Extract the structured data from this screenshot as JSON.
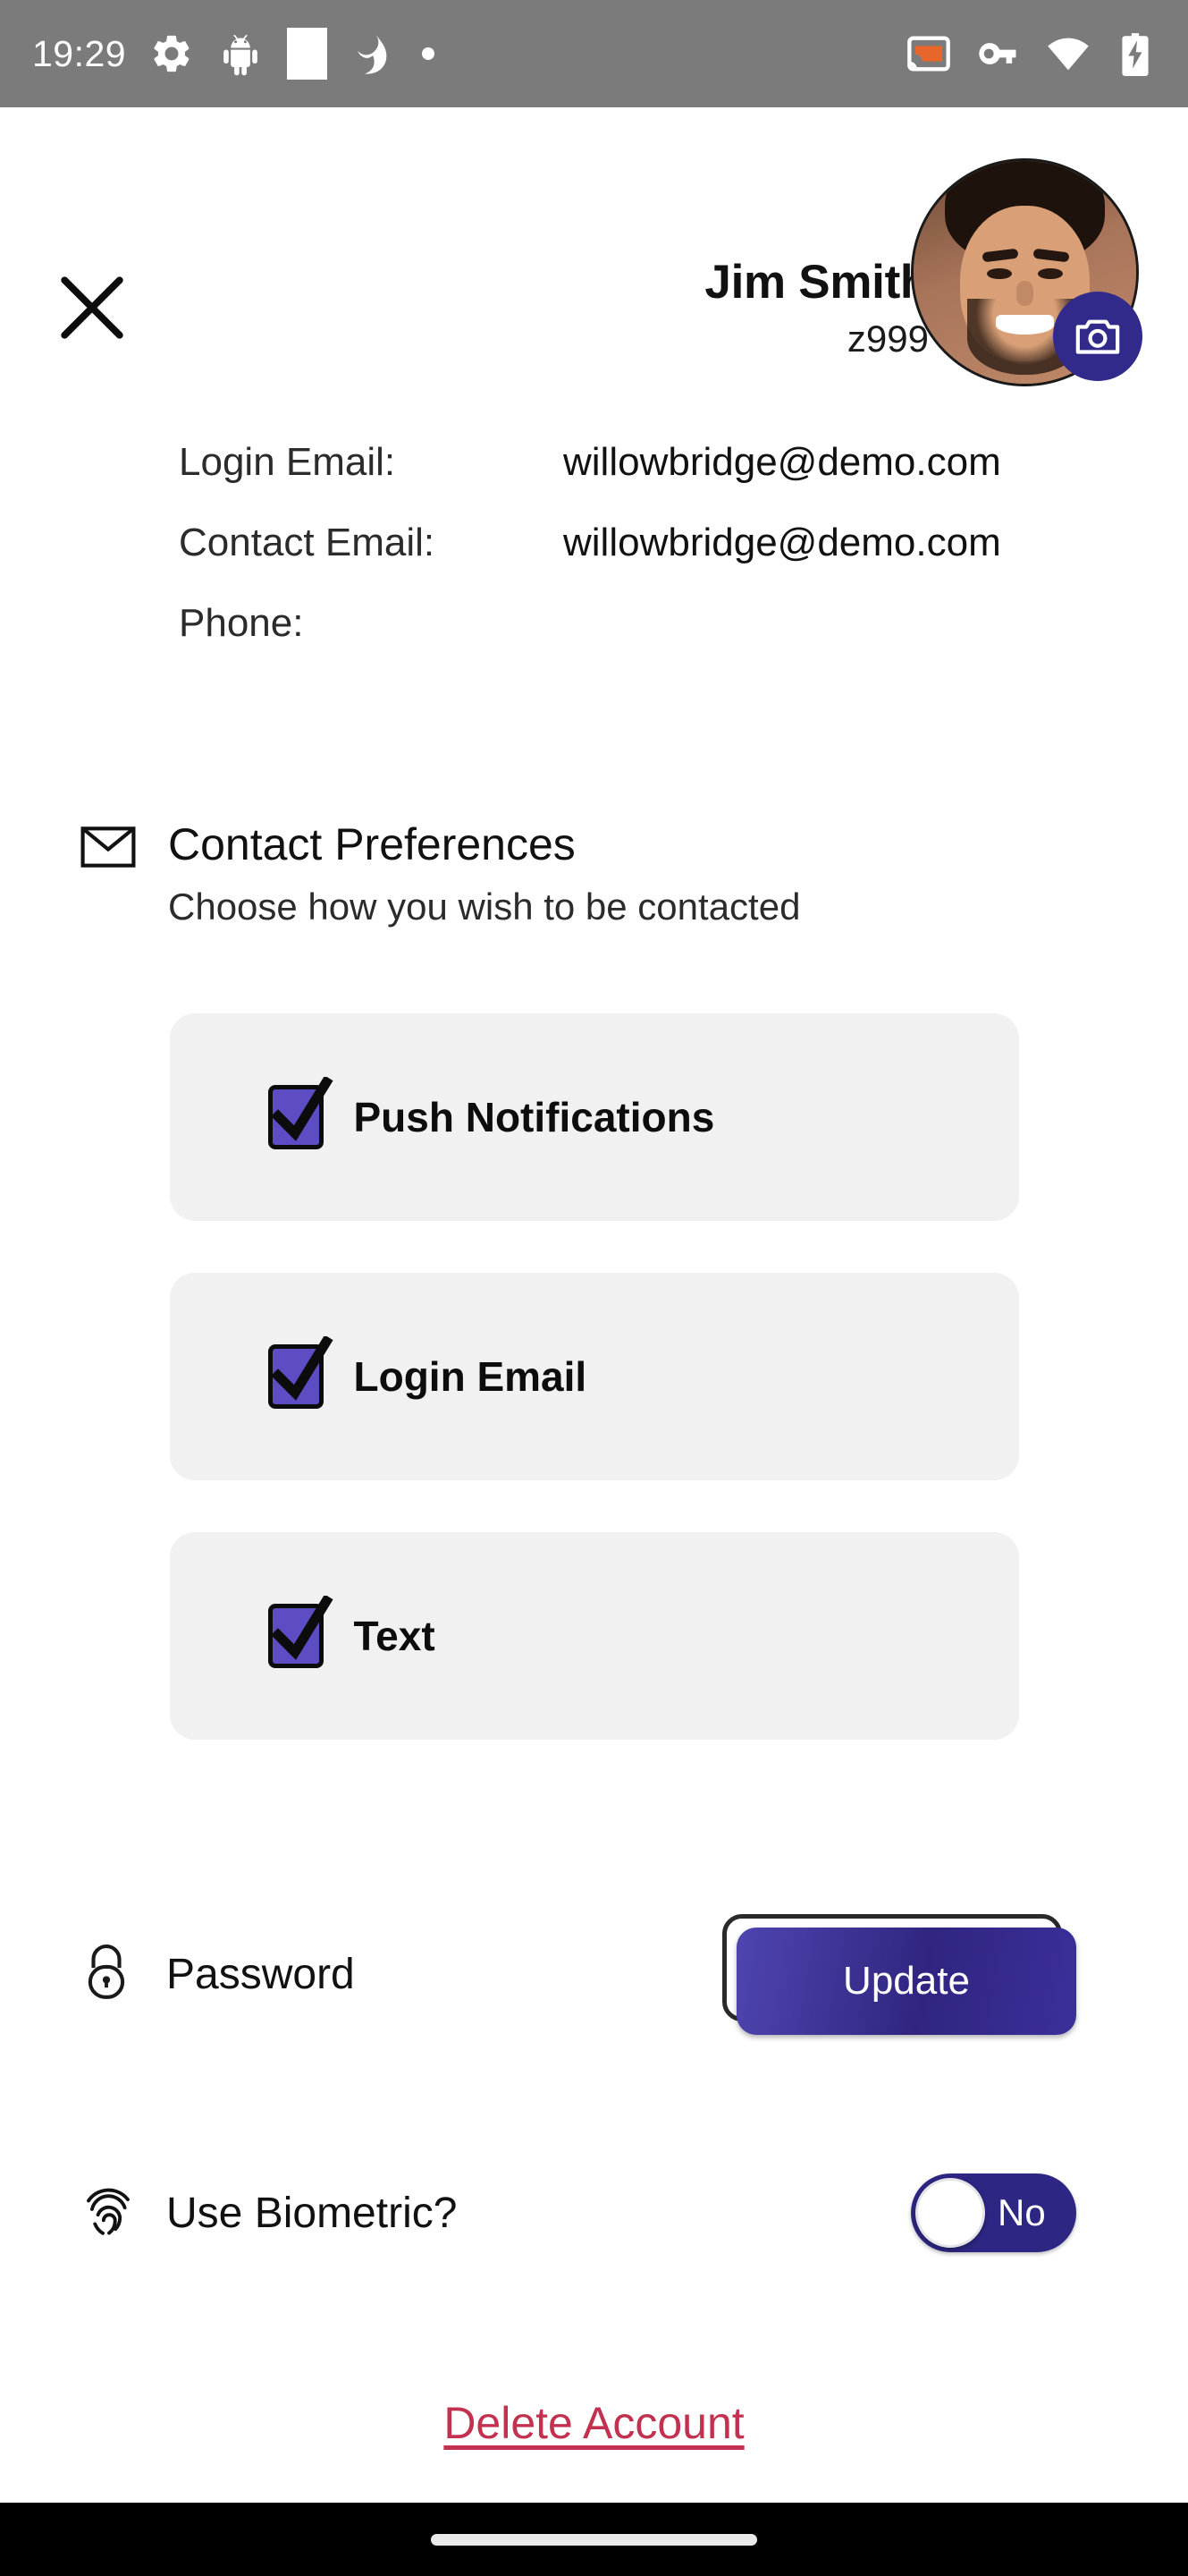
{
  "status_bar": {
    "time": "19:29",
    "left_icons": [
      "gear-icon",
      "android-bug-icon",
      "square-icon",
      "spiral-logo-icon",
      "dot-icon"
    ],
    "right_icons": [
      "cast-icon",
      "vpn-key-icon",
      "wifi-icon",
      "battery-charging-icon"
    ]
  },
  "header": {
    "close_label": "close-icon",
    "name": "Jim Smith",
    "subtitle": "z999",
    "avatar_name": "user-avatar",
    "camera_badge": "camera-icon"
  },
  "info": {
    "rows": [
      {
        "label": "Login Email:",
        "value": "willowbridge@demo.com"
      },
      {
        "label": "Contact Email:",
        "value": "willowbridge@demo.com"
      },
      {
        "label": "Phone:",
        "value": ""
      }
    ]
  },
  "contact_preferences": {
    "icon": "envelope-icon",
    "title": "Contact Preferences",
    "subtitle": "Choose how you wish to be contacted",
    "options": [
      {
        "label": "Push Notifications",
        "checked": true
      },
      {
        "label": "Login Email",
        "checked": true
      },
      {
        "label": "Text",
        "checked": true
      }
    ]
  },
  "password": {
    "icon": "lock-icon",
    "label": "Password",
    "button_label": "Update"
  },
  "biometric": {
    "icon": "fingerprint-icon",
    "label": "Use Biometric?",
    "toggle_value": "No",
    "toggle_on": false
  },
  "delete_account": {
    "label": "Delete Account"
  },
  "colors": {
    "accent_purple": "#5d4dc4",
    "deep_indigo": "#2d2682",
    "danger_red": "#c2314f",
    "card_grey": "#f1f1f1",
    "status_bar_grey": "#7b7b7b"
  }
}
